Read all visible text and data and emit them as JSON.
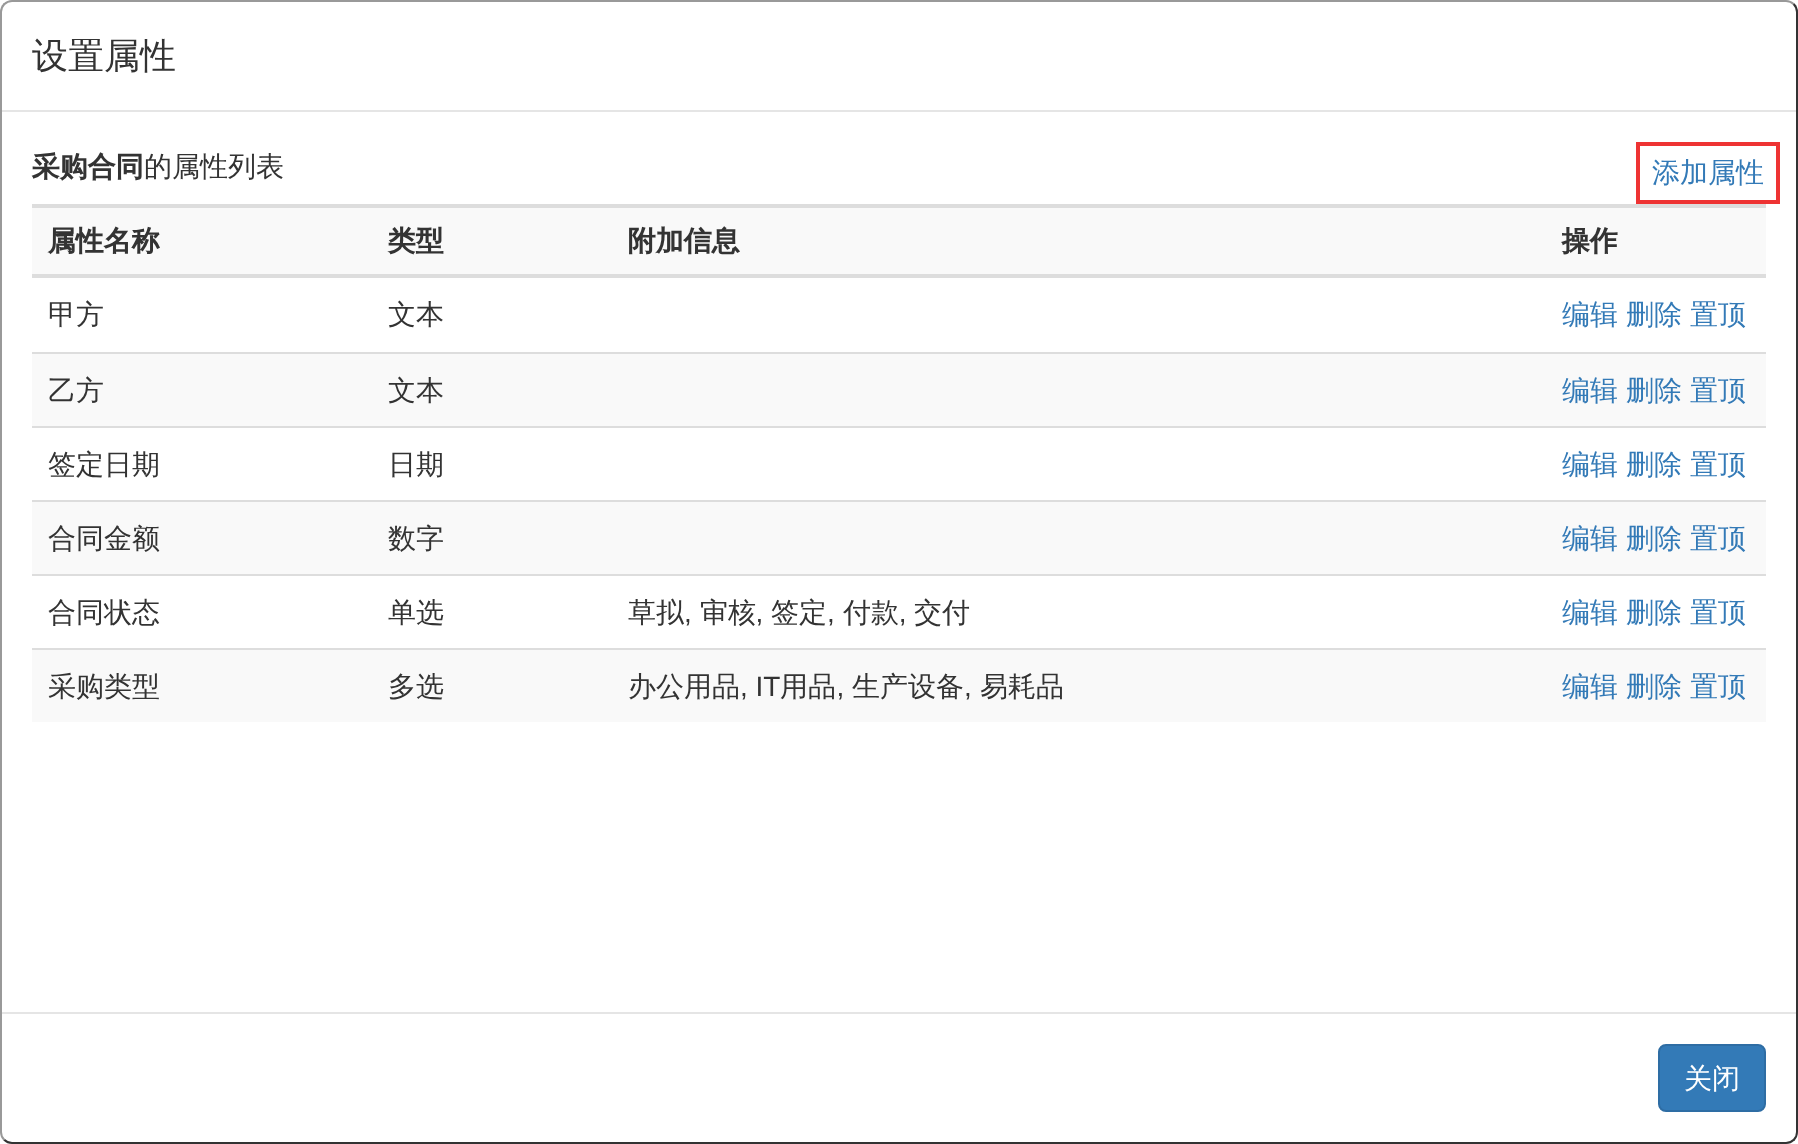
{
  "dialog": {
    "title": "设置属性",
    "list_caption": "**采购合同**的属性列表",
    "add_link": {
      "label": "添加属性",
      "highlighted": true
    },
    "table": {
      "columns": [
        "属性名称",
        "类型",
        "附加信息",
        "操作"
      ],
      "rows": [
        {
          "name": "甲方",
          "type": "文本",
          "extra": "",
          "actions": [
            "编辑",
            "删除",
            "置顶"
          ]
        },
        {
          "name": "乙方",
          "type": "文本",
          "extra": "",
          "actions": [
            "编辑",
            "删除",
            "置顶"
          ]
        },
        {
          "name": "签定日期",
          "type": "日期",
          "extra": "",
          "actions": [
            "编辑",
            "删除",
            "置顶"
          ]
        },
        {
          "name": "合同金额",
          "type": "数字",
          "extra": "",
          "actions": [
            "编辑",
            "删除",
            "置顶"
          ]
        },
        {
          "name": "合同状态",
          "type": "单选",
          "extra": "草拟, 审核, 签定, 付款, 交付",
          "actions": [
            "编辑",
            "删除",
            "置顶"
          ]
        },
        {
          "name": "采购类型",
          "type": "多选",
          "extra": "办公用品, IT用品, 生产设备, 易耗品",
          "actions": [
            "编辑",
            "删除",
            "置顶"
          ]
        }
      ]
    },
    "close_button": "关闭"
  }
}
